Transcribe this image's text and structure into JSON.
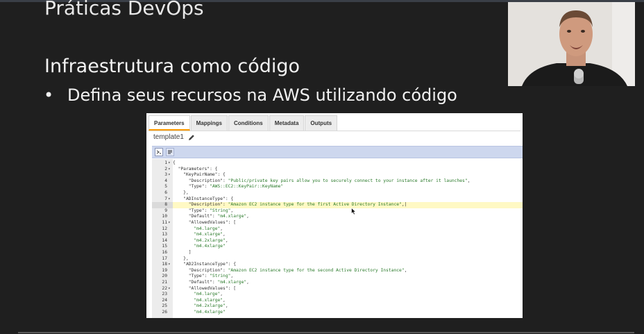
{
  "slide": {
    "title": "Práticas DevOps",
    "subtitle": "Infraestrutura como código",
    "bullet_marker": "•",
    "bullet_text": "Defina seus recursos na AWS utilizando código"
  },
  "panel": {
    "tabs": [
      {
        "label": "Parameters",
        "active": true
      },
      {
        "label": "Mappings",
        "active": false
      },
      {
        "label": "Conditions",
        "active": false
      },
      {
        "label": "Metadata",
        "active": false
      },
      {
        "label": "Outputs",
        "active": false
      }
    ],
    "template_name": "template1"
  },
  "editor": {
    "highlighted_line": "8",
    "lines": [
      {
        "n": "1",
        "fold": true,
        "parts": [
          {
            "t": "{",
            "s": "code"
          }
        ]
      },
      {
        "n": "2",
        "fold": true,
        "parts": [
          {
            "t": "  \"Parameters\": {",
            "s": "key"
          }
        ]
      },
      {
        "n": "3",
        "fold": true,
        "parts": [
          {
            "t": "    \"KeyPairName\": {",
            "s": "key"
          }
        ]
      },
      {
        "n": "4",
        "fold": false,
        "parts": [
          {
            "t": "      \"Description\": ",
            "s": "key"
          },
          {
            "t": "\"Public/private key pairs allow you to securely connect to your instance after it launches\"",
            "s": "str"
          },
          {
            "t": ",",
            "s": "code"
          }
        ]
      },
      {
        "n": "5",
        "fold": false,
        "parts": [
          {
            "t": "      \"Type\": ",
            "s": "key"
          },
          {
            "t": "\"AWS::EC2::KeyPair::KeyName\"",
            "s": "str"
          }
        ]
      },
      {
        "n": "6",
        "fold": false,
        "parts": [
          {
            "t": "    },",
            "s": "code"
          }
        ]
      },
      {
        "n": "7",
        "fold": true,
        "parts": [
          {
            "t": "    \"ADInstanceType\": {",
            "s": "key"
          }
        ]
      },
      {
        "n": "8",
        "fold": false,
        "parts": [
          {
            "t": "      \"Description\": ",
            "s": "key"
          },
          {
            "t": "\"Amazon EC2 instance type for the first Active Directory Instance\"",
            "s": "str"
          },
          {
            "t": ",|",
            "s": "code"
          }
        ]
      },
      {
        "n": "9",
        "fold": false,
        "parts": [
          {
            "t": "      \"Type\": ",
            "s": "key"
          },
          {
            "t": "\"String\"",
            "s": "str"
          },
          {
            "t": ",",
            "s": "code"
          }
        ]
      },
      {
        "n": "10",
        "fold": false,
        "parts": [
          {
            "t": "      \"Default\": ",
            "s": "key"
          },
          {
            "t": "\"m4.xlarge\"",
            "s": "str"
          },
          {
            "t": ",",
            "s": "code"
          }
        ]
      },
      {
        "n": "11",
        "fold": true,
        "parts": [
          {
            "t": "      \"AllowedValues\": [",
            "s": "key"
          }
        ]
      },
      {
        "n": "12",
        "fold": false,
        "parts": [
          {
            "t": "        \"m4.large\"",
            "s": "str"
          },
          {
            "t": ",",
            "s": "code"
          }
        ]
      },
      {
        "n": "13",
        "fold": false,
        "parts": [
          {
            "t": "        \"m4.xlarge\"",
            "s": "str"
          },
          {
            "t": ",",
            "s": "code"
          }
        ]
      },
      {
        "n": "14",
        "fold": false,
        "parts": [
          {
            "t": "        \"m4.2xlarge\"",
            "s": "str"
          },
          {
            "t": ",",
            "s": "code"
          }
        ]
      },
      {
        "n": "15",
        "fold": false,
        "parts": [
          {
            "t": "        \"m4.4xlarge\"",
            "s": "str"
          }
        ]
      },
      {
        "n": "16",
        "fold": false,
        "parts": [
          {
            "t": "      ]",
            "s": "code"
          }
        ]
      },
      {
        "n": "17",
        "fold": false,
        "parts": [
          {
            "t": "    },",
            "s": "code"
          }
        ]
      },
      {
        "n": "18",
        "fold": true,
        "parts": [
          {
            "t": "    \"AD2InstanceType\": {",
            "s": "key"
          }
        ]
      },
      {
        "n": "19",
        "fold": false,
        "parts": [
          {
            "t": "      \"Description\": ",
            "s": "key"
          },
          {
            "t": "\"Amazon EC2 instance type for the second Active Directory Instance\"",
            "s": "str"
          },
          {
            "t": ",",
            "s": "code"
          }
        ]
      },
      {
        "n": "20",
        "fold": false,
        "parts": [
          {
            "t": "      \"Type\": ",
            "s": "key"
          },
          {
            "t": "\"String\"",
            "s": "str"
          },
          {
            "t": ",",
            "s": "code"
          }
        ]
      },
      {
        "n": "21",
        "fold": false,
        "parts": [
          {
            "t": "      \"Default\": ",
            "s": "key"
          },
          {
            "t": "\"m4.xlarge\"",
            "s": "str"
          },
          {
            "t": ",",
            "s": "code"
          }
        ]
      },
      {
        "n": "22",
        "fold": true,
        "parts": [
          {
            "t": "      \"AllowedValues\": [",
            "s": "key"
          }
        ]
      },
      {
        "n": "23",
        "fold": false,
        "parts": [
          {
            "t": "        \"m4.large\"",
            "s": "str"
          },
          {
            "t": ",",
            "s": "code"
          }
        ]
      },
      {
        "n": "24",
        "fold": false,
        "parts": [
          {
            "t": "        \"m4.xlarge\"",
            "s": "str"
          },
          {
            "t": ",",
            "s": "code"
          }
        ]
      },
      {
        "n": "25",
        "fold": false,
        "parts": [
          {
            "t": "        \"m4.2xlarge\"",
            "s": "str"
          },
          {
            "t": ",",
            "s": "code"
          }
        ]
      },
      {
        "n": "26",
        "fold": false,
        "parts": [
          {
            "t": "        \"m4.4xlarge\"",
            "s": "str"
          }
        ]
      }
    ]
  },
  "icons": {
    "pencil": "pencil-icon",
    "format": "format-icon",
    "wrap": "wrap-icon",
    "cursor": "cursor-icon"
  },
  "colors": {
    "slide_background": "#1f1f1f",
    "tab_accent": "#ff9900",
    "toolbar_background": "#cdd7ee",
    "string_green": "#2a7a2a",
    "highlight_line": "#fff9c4"
  }
}
